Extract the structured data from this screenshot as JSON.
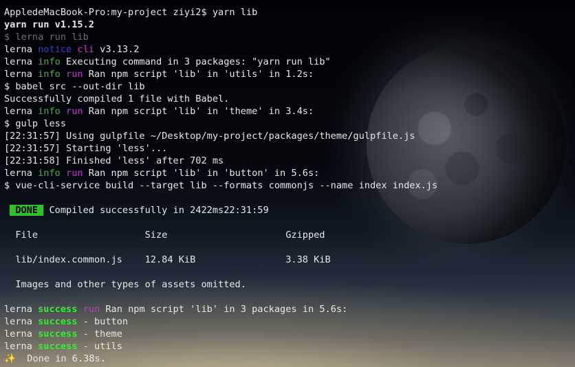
{
  "colors": {
    "text": "#e8e8e8",
    "dim": "#6f6f6f",
    "notice": "#2f3fd8",
    "notice_label": "#c03bc8",
    "info": "#2fbf2f",
    "run": "#c03bc8",
    "success": "#33ee33",
    "done_bg": "#2fbf2f"
  },
  "terminal": {
    "lines": [
      [
        {
          "t": "AppledeMacBook-Pro:my-project ziyi2$ yarn lib"
        }
      ],
      [
        {
          "t": "yarn run v1.15.2",
          "c": "bold"
        }
      ],
      [
        {
          "t": "$ lerna run lib",
          "c": "dim"
        }
      ],
      [
        {
          "t": "lerna "
        },
        {
          "t": "notice",
          "col": "#2f3fd8"
        },
        {
          "t": " "
        },
        {
          "t": "cli",
          "col": "#c03bc8"
        },
        {
          "t": " v3.13.2"
        }
      ],
      [
        {
          "t": "lerna "
        },
        {
          "t": "info",
          "col": "#2fbf2f"
        },
        {
          "t": " Executing command in 3 packages: \"yarn run lib\""
        }
      ],
      [
        {
          "t": "lerna "
        },
        {
          "t": "info",
          "col": "#2fbf2f"
        },
        {
          "t": " "
        },
        {
          "t": "run",
          "col": "#c03bc8"
        },
        {
          "t": " Ran npm script 'lib' in 'utils' in 1.2s:"
        }
      ],
      [
        {
          "t": "$ babel src --out-dir lib"
        }
      ],
      [
        {
          "t": "Successfully compiled 1 file with Babel."
        }
      ],
      [
        {
          "t": "lerna "
        },
        {
          "t": "info",
          "col": "#2fbf2f"
        },
        {
          "t": " "
        },
        {
          "t": "run",
          "col": "#c03bc8"
        },
        {
          "t": " Ran npm script 'lib' in 'theme' in 3.4s:"
        }
      ],
      [
        {
          "t": "$ gulp less"
        }
      ],
      [
        {
          "t": "[22:31:57] Using gulpfile ~/Desktop/my-project/packages/theme/gulpfile.js"
        }
      ],
      [
        {
          "t": "[22:31:57] Starting 'less'..."
        }
      ],
      [
        {
          "t": "[22:31:58] Finished 'less' after 702 ms"
        }
      ],
      [
        {
          "t": "lerna "
        },
        {
          "t": "info",
          "col": "#2fbf2f"
        },
        {
          "t": " "
        },
        {
          "t": "run",
          "col": "#c03bc8"
        },
        {
          "t": " Ran npm script 'lib' in 'button' in 5.6s:"
        }
      ],
      [
        {
          "t": "$ vue-cli-service build --target lib --formats commonjs --name index index.js"
        }
      ],
      [
        {
          "t": ""
        }
      ],
      [
        {
          "t": " "
        },
        {
          "t": " DONE ",
          "c": "bold"
        },
        {
          "t": " Compiled successfully in 2422ms22:31:59"
        }
      ],
      [
        {
          "t": ""
        }
      ],
      [
        {
          "t": "  File                   Size                     Gzipped"
        }
      ],
      [
        {
          "t": ""
        }
      ],
      [
        {
          "t": "  lib/index.common.js    12.84 KiB                3.38 KiB"
        }
      ],
      [
        {
          "t": ""
        }
      ],
      [
        {
          "t": "  Images and other types of assets omitted."
        }
      ],
      [
        {
          "t": ""
        }
      ],
      [
        {
          "t": "lerna "
        },
        {
          "t": "success",
          "col": "#33ee33",
          "c": "bold"
        },
        {
          "t": " "
        },
        {
          "t": "run",
          "col": "#c03bc8"
        },
        {
          "t": " Ran npm script 'lib' in 3 packages in 5.6s:"
        }
      ],
      [
        {
          "t": "lerna "
        },
        {
          "t": "success",
          "col": "#33ee33",
          "c": "bold"
        },
        {
          "t": " - button"
        }
      ],
      [
        {
          "t": "lerna "
        },
        {
          "t": "success",
          "col": "#33ee33",
          "c": "bold"
        },
        {
          "t": " - theme"
        }
      ],
      [
        {
          "t": "lerna "
        },
        {
          "t": "success",
          "col": "#33ee33",
          "c": "bold"
        },
        {
          "t": " - utils"
        }
      ],
      [
        {
          "t": "✨  Done in 6.38s."
        }
      ]
    ]
  }
}
